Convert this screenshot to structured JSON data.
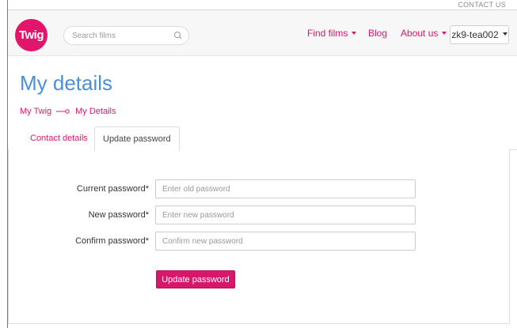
{
  "header": {
    "contact_label": "CONTACT US",
    "logo_text": "Twig",
    "search_placeholder": "Search films",
    "nav": {
      "find_films": "Find films",
      "blog": "Blog",
      "about_us": "About us"
    },
    "user_label": "zk9-tea002"
  },
  "page": {
    "title": "My details",
    "breadcrumb": [
      "My Twig",
      "My Details"
    ]
  },
  "tabs": [
    "Contact details",
    "Update password"
  ],
  "form": {
    "fields": [
      {
        "label": "Current password*",
        "placeholder": "Enter old password",
        "value": ""
      },
      {
        "label": "New password*",
        "placeholder": "Enter new password",
        "value": ""
      },
      {
        "label": "Confirm password*",
        "placeholder": "Confirm new password",
        "value": ""
      }
    ],
    "submit_label": "Update password"
  },
  "colors": {
    "brand": "#e2156b",
    "title": "#4a90d9"
  }
}
